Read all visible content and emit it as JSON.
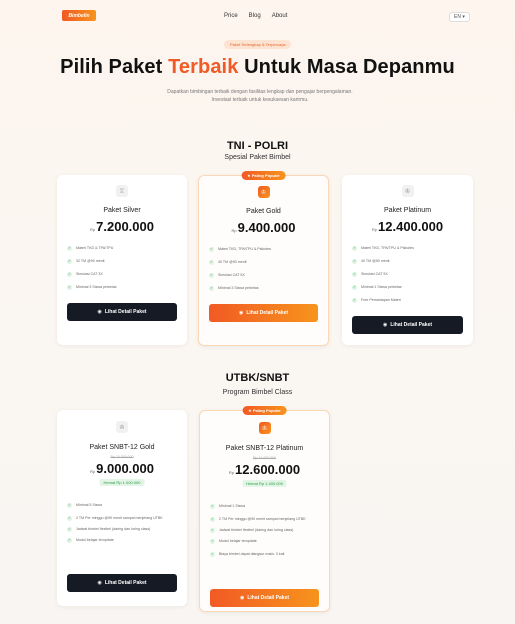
{
  "nav": {
    "logo": "Bimbelin",
    "links": [
      "Price",
      "Blog",
      "About"
    ],
    "lang": "EN ▾"
  },
  "hero": {
    "pill": "Paket Terlengkap & Terpercaya",
    "title_pre": "Pilih Paket ",
    "title_accent": "Terbaik",
    "title_post": " Untuk Masa Depanmu",
    "subtitle": "Dapatkan bimbingan terbaik dengan fasilitas lengkap dan pengajar berpengalaman. Investasi terbaik untuk kesuksesan karirmu."
  },
  "sections": [
    {
      "title": "TNI - POLRI",
      "subtitle": "Spesial Paket Bimbel",
      "cards": [
        {
          "name": "Paket Silver",
          "currency": "Rp",
          "price": "7.200.000",
          "highlight": false,
          "icon": "award-icon",
          "features": [
            "Materi TKD & TPA/TPU",
            "32 TM @90 menit",
            "Simulasi CAT 3X",
            "Minimal 3 Siswa perkelas"
          ],
          "button": "Lihat Detail Paket"
        },
        {
          "name": "Paket Gold",
          "currency": "Rp",
          "price": "9.400.000",
          "highlight": true,
          "badge": "★ Paling Populer",
          "icon": "crown-icon",
          "features": [
            "Materi TKD, TPA/TPU & Psikotes",
            "40 TM @90 menit",
            "Simulasi CAT 5X",
            "Minimal 3 Siswa perkelas"
          ],
          "button": "Lihat Detail Paket"
        },
        {
          "name": "Paket Platinum",
          "currency": "Rp",
          "price": "12.400.000",
          "highlight": false,
          "icon": "crown-icon",
          "features": [
            "Materi TKD, TPA/TPU & Psikotes",
            "40 TM @90 menit",
            "Simulasi CAT 5X",
            "Minimal 1 Siswa perkelas",
            "Free Pemantapan Materi"
          ],
          "button": "Lihat Detail Paket"
        }
      ]
    },
    {
      "title": "UTBK/SNBT",
      "subtitle": "Program Bimbel Class",
      "cards": [
        {
          "name": "Paket SNBT-12 Gold",
          "strike": "Rp 10.000.000",
          "currency": "Rp",
          "price": "9.000.000",
          "save": "Hemat Rp 1.000.000",
          "highlight": false,
          "icon": "crown-icon",
          "features": [
            "Minimal 5 Siswa",
            "2 TM Per minggu @90 menit sampai menjelang UTBK",
            "Jadwal bimbel flexibel (daring dan luring class)",
            "Modul belajar terupdate"
          ],
          "button": "Lihat Detail Paket"
        },
        {
          "name": "Paket SNBT-12 Platinum",
          "strike": "Rp 14.000.000",
          "currency": "Rp",
          "price": "12.600.000",
          "save": "Hemat Rp 1.400.000",
          "highlight": true,
          "badge": "★ Paling Populer",
          "icon": "crown-icon",
          "features": [
            "Minimal 1 Siswa",
            "2 TM Per minggu @90 menit sampai menjelang UTBK",
            "Jadwal bimbel flexibel (daring dan luring class)",
            "Modul belajar terupdate",
            "Biaya bimbel dapat diangsur maks. 3 kali"
          ],
          "button": "Lihat Detail Paket"
        }
      ]
    }
  ],
  "colors": {
    "accent": "#f15a24",
    "accent2": "#f7941d",
    "dark_button": "#151a24",
    "check_green": "#34a853"
  }
}
